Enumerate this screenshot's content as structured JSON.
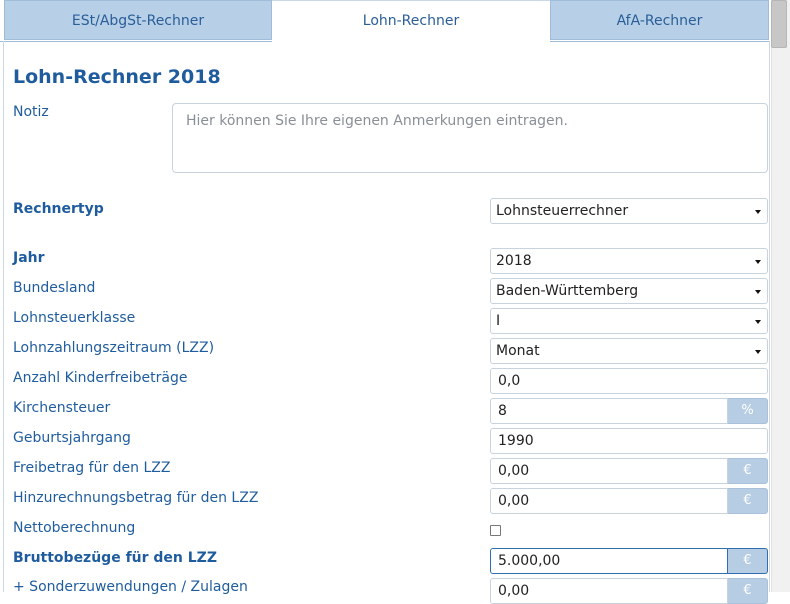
{
  "tabs": [
    {
      "label": "ESt/AbgSt-Rechner",
      "active": false
    },
    {
      "label": "Lohn-Rechner",
      "active": true
    },
    {
      "label": "AfA-Rechner",
      "active": false
    }
  ],
  "title": "Lohn-Rechner 2018",
  "note": {
    "label": "Notiz",
    "placeholder": "Hier können Sie Ihre eigenen Anmerkungen eintragen."
  },
  "rechnertyp": {
    "label": "Rechnertyp",
    "value": "Lohnsteuerrechner"
  },
  "jahr": {
    "label": "Jahr",
    "value": "2018"
  },
  "bundesland": {
    "label": "Bundesland",
    "value": "Baden-Württemberg"
  },
  "steuerklasse": {
    "label": "Lohnsteuerklasse",
    "value": "I"
  },
  "lzz": {
    "label": "Lohnzahlungszeitraum (LZZ)",
    "value": "Monat"
  },
  "kinder": {
    "label": "Anzahl Kinderfreibeträge",
    "value": "0,0"
  },
  "kirchensteuer": {
    "label": "Kirchensteuer",
    "value": "8",
    "unit": "%"
  },
  "geburtsjahrgang": {
    "label": "Geburtsjahrgang",
    "value": "1990"
  },
  "freibetrag": {
    "label": "Freibetrag für den LZZ",
    "value": "0,00",
    "unit": "€"
  },
  "hinzurechnung": {
    "label": "Hinzurechnungsbetrag für den LZZ",
    "value": "0,00",
    "unit": "€"
  },
  "netto": {
    "label": "Nettoberechnung",
    "checked": false
  },
  "brutto": {
    "label": "Bruttobezüge für den LZZ",
    "value": "5.000,00",
    "unit": "€"
  },
  "sonder": {
    "label": "+ Sonderzuwendungen / Zulagen",
    "value": "0,00",
    "unit": "€"
  },
  "colors": {
    "accent": "#1f5c9e",
    "tab_inactive": "#b7d0e8",
    "addon": "#b7cde3"
  }
}
